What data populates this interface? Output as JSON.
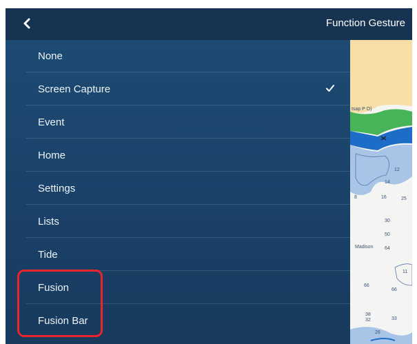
{
  "header": {
    "title": "Function Gesture",
    "back_icon": "chevron-left-icon"
  },
  "menu": {
    "selected": "Screen Capture",
    "items": [
      {
        "label": "None"
      },
      {
        "label": "Screen Capture"
      },
      {
        "label": "Event"
      },
      {
        "label": "Home"
      },
      {
        "label": "Settings"
      },
      {
        "label": "Lists"
      },
      {
        "label": "Tide"
      },
      {
        "label": "Fusion"
      },
      {
        "label": "Fusion Bar"
      }
    ]
  },
  "chart": {
    "place_labels": [
      "tsap P O)",
      "Madison"
    ],
    "depths": [
      "12",
      "14",
      "25",
      "8",
      "16",
      "30",
      "50",
      "64",
      "66",
      "66",
      "11",
      "38",
      "32",
      "33",
      "26"
    ]
  },
  "colors": {
    "header_bg": "#173352",
    "menu_bg": "#1b456c",
    "highlight": "#e8242c",
    "land": "#f5dfa6",
    "shallow_water": "#a8c4e6",
    "deep_blue": "#1d6cc7"
  }
}
